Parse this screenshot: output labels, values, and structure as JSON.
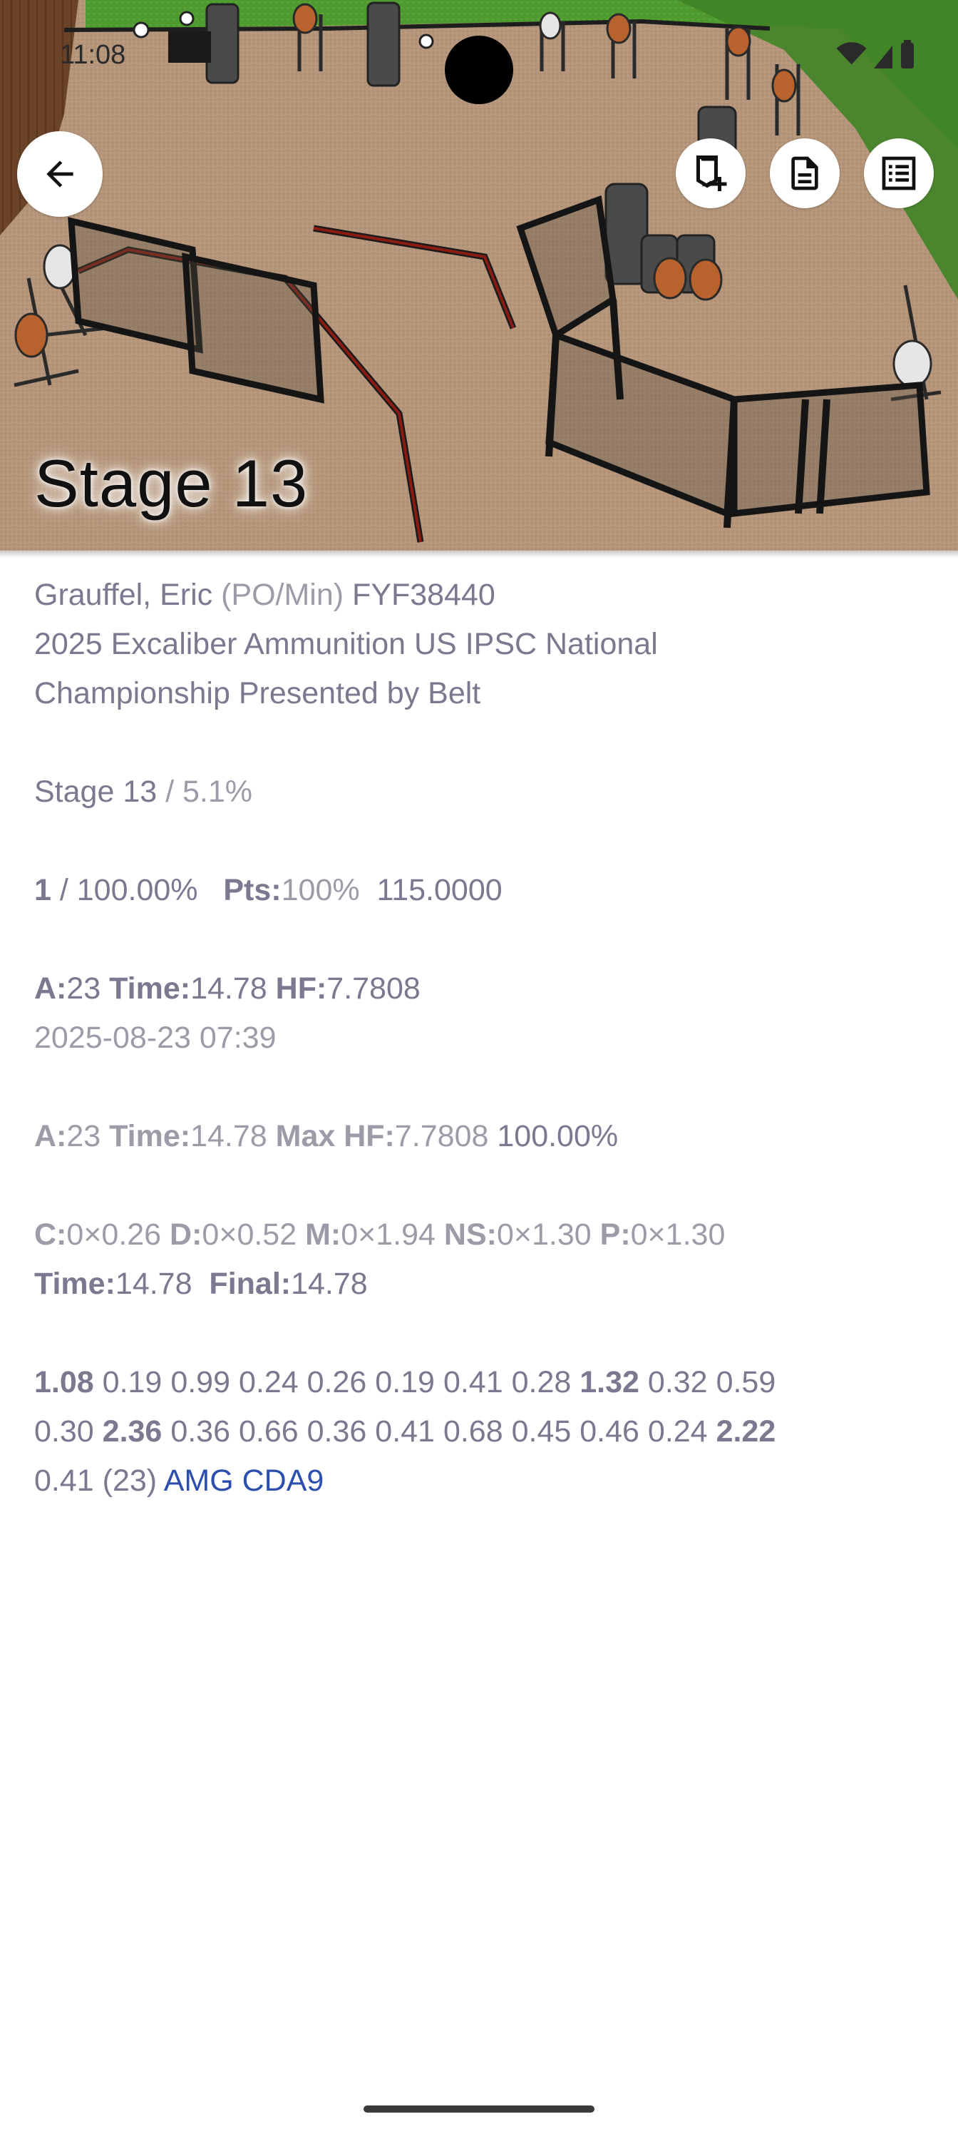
{
  "status_bar": {
    "time": "11:08"
  },
  "header": {
    "title": "Stage 13",
    "back_label": "Back",
    "actions": [
      "bookmark-add",
      "document",
      "list"
    ]
  },
  "competitor": {
    "name": "Grauffel, Eric",
    "division": "(PO/Min)",
    "member_id": "FYF38440",
    "match_line1": "2025 Excaliber Ammunition US IPSC National",
    "match_line2": "Championship Presented by Belt"
  },
  "stage": {
    "name": "Stage 13",
    "weight": "/ 5.1%",
    "place": "1",
    "place_pct": "/ 100.00%",
    "pts_label": "Pts:",
    "pts_value": "100%",
    "stage_points": "115.0000"
  },
  "score": {
    "a_label": "A:",
    "a_value": "23",
    "time_label": "Time:",
    "time_value": "14.78",
    "hf_label": "HF:",
    "hf_value": "7.7808",
    "timestamp": "2025-08-23 07:39"
  },
  "max": {
    "a_label": "A:",
    "a_value": "23",
    "time_label": "Time:",
    "time_value": "14.78",
    "hf_label": "Max HF:",
    "hf_value": "7.7808",
    "pct": "100.00%"
  },
  "penalties": {
    "c_label": "C:",
    "c_value": "0×0.26",
    "d_label": "D:",
    "d_value": "0×0.52",
    "m_label": "M:",
    "m_value": "0×1.94",
    "ns_label": "NS:",
    "ns_value": "0×1.30",
    "p_label": "P:",
    "p_value": "0×1.30",
    "time_label": "Time:",
    "time_value": "14.78",
    "final_label": "Final:",
    "final_value": "14.78"
  },
  "splits": {
    "line1": [
      {
        "v": "1.08",
        "bold": true
      },
      {
        "v": "0.19"
      },
      {
        "v": "0.99"
      },
      {
        "v": "0.24"
      },
      {
        "v": "0.26"
      },
      {
        "v": "0.19"
      },
      {
        "v": "0.41"
      },
      {
        "v": "0.28"
      },
      {
        "v": "1.32",
        "bold": true
      },
      {
        "v": "0.32"
      },
      {
        "v": "0.59"
      }
    ],
    "line2": [
      {
        "v": "0.30"
      },
      {
        "v": "2.36",
        "bold": true
      },
      {
        "v": "0.36"
      },
      {
        "v": "0.66"
      },
      {
        "v": "0.36"
      },
      {
        "v": "0.41"
      },
      {
        "v": "0.68"
      },
      {
        "v": "0.45"
      },
      {
        "v": "0.46"
      },
      {
        "v": "0.24"
      },
      {
        "v": "2.22",
        "bold": true
      }
    ],
    "line3_value": "0.41",
    "count": "(23)",
    "timer": "AMG CDA9"
  },
  "colors": {
    "text": "#7b7890",
    "muted": "#9e9ba8",
    "link": "#2c4fae",
    "dirt": "#b7977a",
    "grass": "#4f9a2e"
  }
}
